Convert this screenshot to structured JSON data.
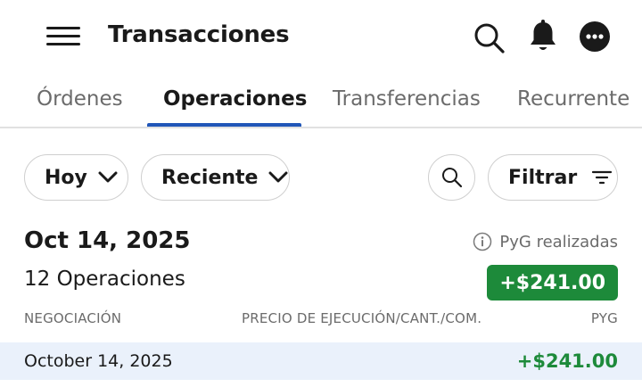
{
  "header": {
    "title": "Transacciones",
    "icons": [
      "menu-icon",
      "search-icon",
      "bell-icon",
      "more-icon"
    ]
  },
  "tabs": [
    {
      "label": "Órdenes"
    },
    {
      "label": "Operaciones"
    },
    {
      "label": "Transferencias"
    },
    {
      "label": "Recurrente"
    }
  ],
  "active_tab": "Operaciones",
  "filters": {
    "period_label": "Hoy",
    "sort_label": "Reciente",
    "filter_label": "Filtrar"
  },
  "summary": {
    "date": "Oct 14, 2025",
    "realized_label": "PyG realizadas",
    "operations_count": "12 Operaciones",
    "total": "+$241.00"
  },
  "columns": {
    "left": "NEGOCIACIÓN",
    "middle": "PRECIO DE EJECUCIÓN/CANT./COM.",
    "right": "PYG"
  },
  "rows": [
    {
      "date": "October 14, 2025",
      "amount": "+$241.00"
    }
  ],
  "colors": {
    "accent_blue": "#2157b8",
    "positive_green": "#1d8a3a",
    "row_highlight": "#eaf1fb"
  }
}
